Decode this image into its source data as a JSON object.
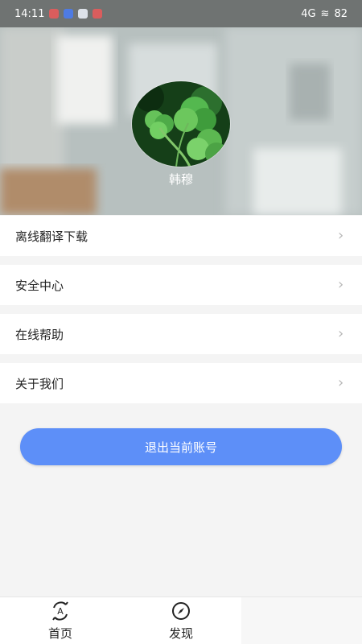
{
  "status": {
    "time": "14:11",
    "network": "4G",
    "battery": "82"
  },
  "profile": {
    "username": "韩穆"
  },
  "menu": {
    "items": [
      {
        "label": "离线翻译下载"
      },
      {
        "label": "安全中心"
      },
      {
        "label": "在线帮助"
      },
      {
        "label": "关于我们"
      }
    ]
  },
  "actions": {
    "logout": "退出当前账号"
  },
  "tabs": [
    {
      "label": "首页",
      "icon": "translate-icon"
    },
    {
      "label": "发现",
      "icon": "compass-icon"
    }
  ]
}
